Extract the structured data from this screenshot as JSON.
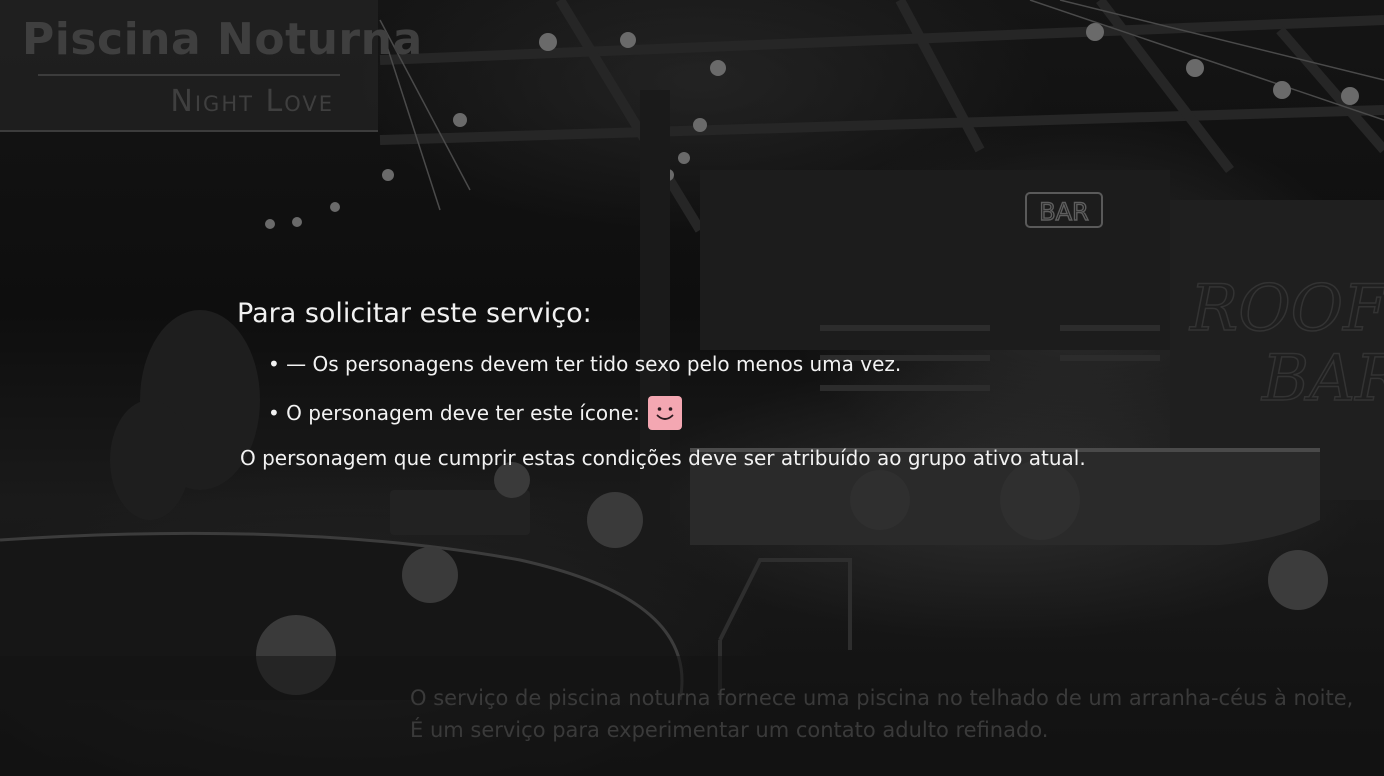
{
  "title": {
    "main": "Piscina Noturna",
    "sub": "Night Love"
  },
  "requirements": {
    "heading": "Para solicitar este serviço:",
    "item_1": "• — Os personagens devem ter tido sexo pelo menos uma vez.",
    "item_2": "• O personagem deve ter este ícone:",
    "item_2_icon": "smiley-face-icon",
    "item_2_icon_color": "#f4a7b2",
    "footer": "O personagem que cumprir estas condições deve ser atribuído ao grupo ativo atual."
  },
  "description": {
    "line_1": "O serviço de piscina noturna fornece uma piscina no telhado de um arranha-céus à noite,",
    "line_2": "É um serviço para experimentar um contato adulto refinado."
  },
  "background": {
    "neon_sign_bar": "BAR",
    "neon_sign_rooftop_1": "ROOF T",
    "neon_sign_rooftop_2": "BAR"
  }
}
